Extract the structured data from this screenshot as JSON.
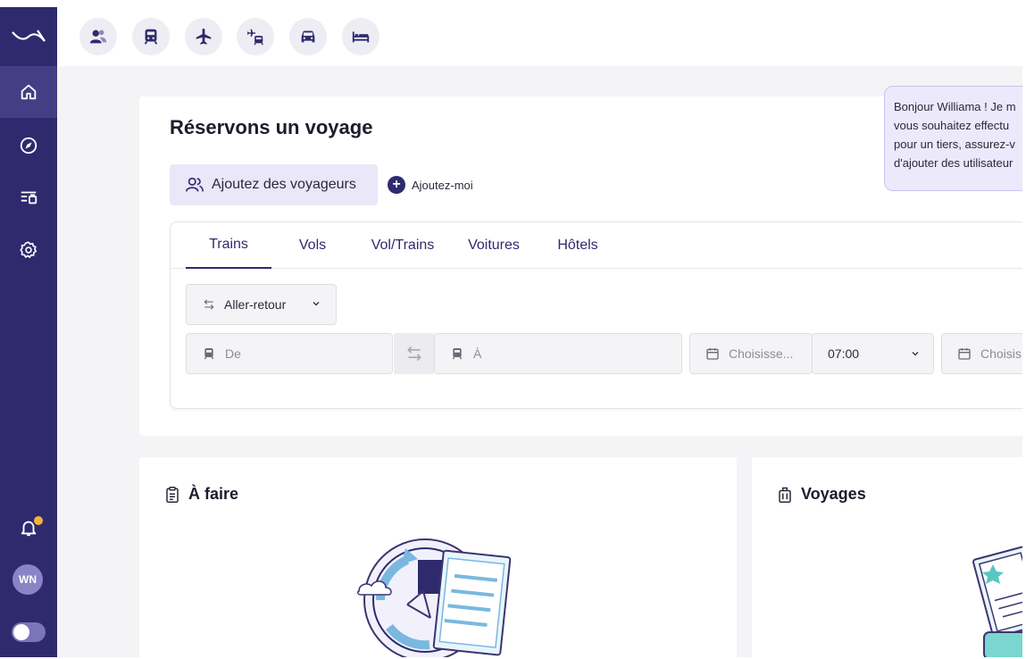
{
  "sidebar": {
    "logo_icon": "brand-logo-icon",
    "items": [
      {
        "name": "home",
        "icon": "home-icon"
      },
      {
        "name": "compass",
        "icon": "compass-icon"
      },
      {
        "name": "trips",
        "icon": "trips-list-icon"
      },
      {
        "name": "settings",
        "icon": "gear-icon"
      }
    ],
    "notifications_icon": "bell-icon",
    "avatar_initials": "WN"
  },
  "topbar": {
    "icons": [
      "travellers-icon",
      "train-icon",
      "plane-icon",
      "plane-train-icon",
      "car-icon",
      "hotel-bed-icon"
    ]
  },
  "booking": {
    "title": "Réservons un voyage",
    "add_travellers_label": "Ajoutez des voyageurs",
    "add_me_label": "Ajoutez-moi",
    "tabs": [
      "Trains",
      "Vols",
      "Vol/Trains",
      "Voitures",
      "Hôtels"
    ],
    "active_tab": "Trains",
    "trip_type": "Aller-retour",
    "from_placeholder": "De",
    "to_placeholder": "À",
    "date_placeholder": "Choisisse...",
    "time_value": "07:00",
    "return_date_placeholder": "Choisis"
  },
  "assistant": {
    "lines": [
      "Bonjour Williama ! Je m",
      "vous souhaitez effectu",
      "pour un tiers, assurez-v",
      "d'ajouter des utilisateur"
    ]
  },
  "todo": {
    "title": "À faire"
  },
  "trips": {
    "title": "Voyages"
  },
  "colors": {
    "primary": "#2f2a6e",
    "accent_light": "#e9e7f8",
    "badge": "#f2b33d",
    "background": "#f4f4f6"
  }
}
